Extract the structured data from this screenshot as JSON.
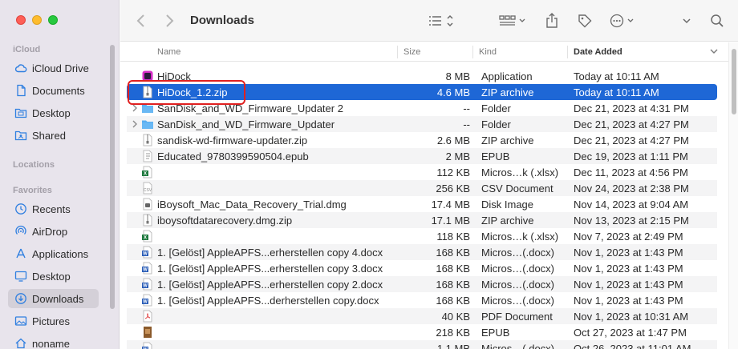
{
  "window": {
    "title": "Downloads"
  },
  "sidebar": {
    "sections": [
      {
        "label": "iCloud",
        "items": [
          {
            "label": "iCloud Drive",
            "icon": "cloud-icon"
          },
          {
            "label": "Documents",
            "icon": "doc-icon"
          },
          {
            "label": "Desktop",
            "icon": "desktop-folder-icon"
          },
          {
            "label": "Shared",
            "icon": "shared-folder-icon"
          }
        ]
      },
      {
        "label": "Locations",
        "items": []
      },
      {
        "label": "Favorites",
        "items": [
          {
            "label": "Recents",
            "icon": "clock-icon"
          },
          {
            "label": "AirDrop",
            "icon": "airdrop-icon"
          },
          {
            "label": "Applications",
            "icon": "applications-icon"
          },
          {
            "label": "Desktop",
            "icon": "desktop-icon"
          },
          {
            "label": "Downloads",
            "icon": "download-icon",
            "active": true
          },
          {
            "label": "Pictures",
            "icon": "pictures-icon"
          },
          {
            "label": "noname",
            "icon": "home-icon"
          }
        ]
      }
    ]
  },
  "columns": {
    "name": "Name",
    "size": "Size",
    "kind": "Kind",
    "date": "Date Added"
  },
  "files": [
    {
      "name": "HiDock",
      "size": "8 MB",
      "kind": "Application",
      "date": "Today at 10:11 AM",
      "icon": "app",
      "disclosure": false
    },
    {
      "name": "HiDock_1.2.zip",
      "size": "4.6 MB",
      "kind": "ZIP archive",
      "date": "Today at 10:11 AM",
      "icon": "zip",
      "disclosure": false,
      "selected": true
    },
    {
      "name": "SanDisk_and_WD_Firmware_Updater 2",
      "size": "--",
      "kind": "Folder",
      "date": "Dec 21, 2023 at 4:31 PM",
      "icon": "folder",
      "disclosure": true
    },
    {
      "name": "SanDisk_and_WD_Firmware_Updater",
      "size": "--",
      "kind": "Folder",
      "date": "Dec 21, 2023 at 4:27 PM",
      "icon": "folder",
      "disclosure": true
    },
    {
      "name": "sandisk-wd-firmware-updater.zip",
      "size": "2.6 MB",
      "kind": "ZIP archive",
      "date": "Dec 21, 2023 at 4:27 PM",
      "icon": "zip",
      "disclosure": false
    },
    {
      "name": "Educated_9780399590504.epub",
      "size": "2 MB",
      "kind": "EPUB",
      "date": "Dec 19, 2023 at 1:11 PM",
      "icon": "epub",
      "disclosure": false
    },
    {
      "name": "",
      "size": "112 KB",
      "kind": "Micros…k (.xlsx)",
      "date": "Dec 11, 2023 at 4:56 PM",
      "icon": "xlsx",
      "disclosure": false
    },
    {
      "name": "",
      "size": "256 KB",
      "kind": "CSV Document",
      "date": "Nov 24, 2023 at 2:38 PM",
      "icon": "csv",
      "disclosure": false
    },
    {
      "name": "iBoysoft_Mac_Data_Recovery_Trial.dmg",
      "size": "17.4 MB",
      "kind": "Disk Image",
      "date": "Nov 14, 2023 at 9:04 AM",
      "icon": "dmg",
      "disclosure": false
    },
    {
      "name": "iboysoftdatarecovery.dmg.zip",
      "size": "17.1 MB",
      "kind": "ZIP archive",
      "date": "Nov 13, 2023 at 2:15 PM",
      "icon": "zip",
      "disclosure": false
    },
    {
      "name": "",
      "size": "118 KB",
      "kind": "Micros…k (.xlsx)",
      "date": "Nov 7, 2023 at 2:49 PM",
      "icon": "xlsx",
      "disclosure": false
    },
    {
      "name": "1. [Gelöst] AppleAPFS...erherstellen copy 4.docx",
      "size": "168 KB",
      "kind": "Micros…(.docx)",
      "date": "Nov 1, 2023 at 1:43 PM",
      "icon": "docx",
      "disclosure": false
    },
    {
      "name": "1. [Gelöst] AppleAPFS...erherstellen copy 3.docx",
      "size": "168 KB",
      "kind": "Micros…(.docx)",
      "date": "Nov 1, 2023 at 1:43 PM",
      "icon": "docx",
      "disclosure": false
    },
    {
      "name": "1. [Gelöst] AppleAPFS...erherstellen copy 2.docx",
      "size": "168 KB",
      "kind": "Micros…(.docx)",
      "date": "Nov 1, 2023 at 1:43 PM",
      "icon": "docx",
      "disclosure": false
    },
    {
      "name": "1. [Gelöst] AppleAPFS...derherstellen copy.docx",
      "size": "168 KB",
      "kind": "Micros…(.docx)",
      "date": "Nov 1, 2023 at 1:43 PM",
      "icon": "docx",
      "disclosure": false
    },
    {
      "name": "",
      "size": "40 KB",
      "kind": "PDF Document",
      "date": "Nov 1, 2023 at 10:31 AM",
      "icon": "pdf",
      "disclosure": false
    },
    {
      "name": "",
      "size": "218 KB",
      "kind": "EPUB",
      "date": "Oct 27, 2023 at 1:47 PM",
      "icon": "epub-book",
      "disclosure": false
    },
    {
      "name": "",
      "size": "1.1 MB",
      "kind": "Micros…(.docx)",
      "date": "Oct 26, 2023 at 11:01 AM",
      "icon": "docx",
      "disclosure": false
    }
  ],
  "colors": {
    "selection": "#1e67d6",
    "highlight": "#e02020",
    "folder": "#5aaef0"
  }
}
